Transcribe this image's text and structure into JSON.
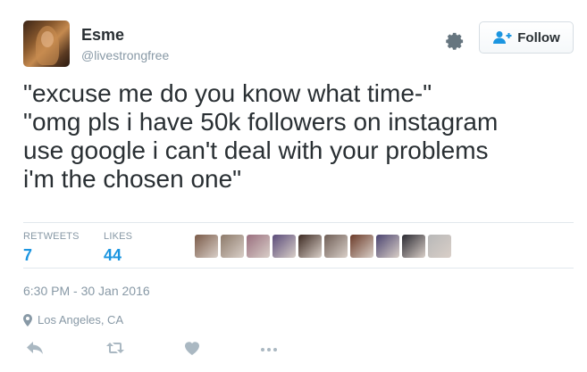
{
  "user": {
    "name": "Esme",
    "handle": "@livestrongfree"
  },
  "follow_button": {
    "label": "Follow"
  },
  "tweet": {
    "lines": [
      "\"excuse me do you know what time-\"",
      "\"omg pls i have 50k followers on instagram",
      "use google i can't deal with your problems",
      "i'm the chosen one\""
    ]
  },
  "stats": {
    "retweets_label": "RETWEETS",
    "retweets_count": "7",
    "likes_label": "LIKES",
    "likes_count": "44"
  },
  "likers": [
    {
      "color": "#7a5a48"
    },
    {
      "color": "#8d7a6a"
    },
    {
      "color": "#9a6f7f"
    },
    {
      "color": "#5a4b7a"
    },
    {
      "color": "#3d2a22"
    },
    {
      "color": "#6f5e56"
    },
    {
      "color": "#6b3a28"
    },
    {
      "color": "#4b4470"
    },
    {
      "color": "#2b2a32"
    },
    {
      "color": "#b8b8b8"
    }
  ],
  "meta": {
    "timestamp": "6:30 PM - 30 Jan 2016",
    "location": "Los Angeles, CA"
  },
  "icons": {
    "settings": "gear-icon",
    "follow": "add-user-icon",
    "location": "map-pin-icon",
    "reply": "reply-icon",
    "retweet": "retweet-icon",
    "like": "heart-icon",
    "more": "more-icon"
  },
  "colors": {
    "link_blue": "#1b95e0",
    "muted": "#8899a6",
    "text": "#292f33",
    "action_icon": "#aab8c2"
  }
}
